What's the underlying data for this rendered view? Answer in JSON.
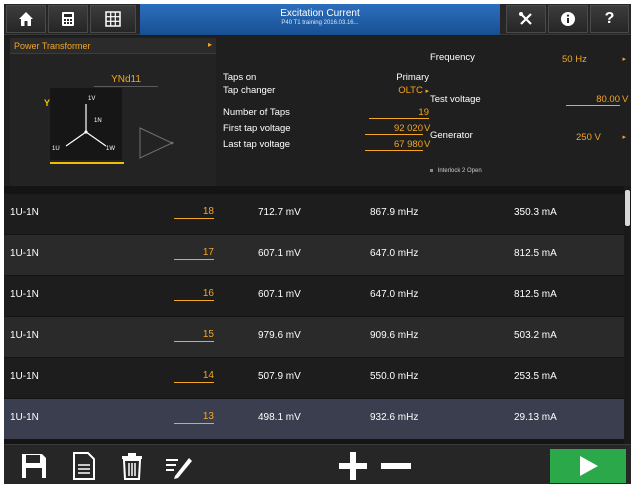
{
  "header": {
    "title": "Excitation Current",
    "subtitle": "P40 T1 training 2016.03.16..."
  },
  "icons": {
    "home": "home-icon",
    "calculator": "calculator-icon",
    "grid": "grid-icon",
    "tools": "tools-icon",
    "info": "info-icon",
    "help": "help-icon"
  },
  "buttons": {
    "help_label": "?"
  },
  "transformer": {
    "type_label": "Power Transformer",
    "vector_group": "YNd11",
    "primary_winding": "YN",
    "secondary_winding": "d11",
    "phase_1v": "1V",
    "phase_1n": "1N",
    "phase_1u": "1U",
    "phase_1w": "1W"
  },
  "taps": {
    "taps_on_label": "Taps on",
    "taps_on_value": "Primary",
    "tap_changer_label": "Tap changer",
    "tap_changer_value": "OLTC",
    "number_of_taps_label": "Number of Taps",
    "number_of_taps_value": "19",
    "first_tap_voltage_label": "First tap voltage",
    "first_tap_voltage_value": "92 020",
    "last_tap_voltage_label": "Last tap voltage",
    "last_tap_voltage_value": "67 980",
    "voltage_unit": "V"
  },
  "measurement": {
    "frequency_label": "Frequency",
    "frequency_value": "50 Hz",
    "test_voltage_label": "Test voltage",
    "test_voltage_value": "80.00",
    "test_voltage_unit": "V",
    "generator_label": "Generator",
    "generator_value": "250 V",
    "interlock_text": "Interlock 2 Open"
  },
  "table": {
    "rows": [
      {
        "phase": "1U-1N",
        "tap": "18",
        "voltage": "712.7 mV",
        "frequency": "867.9 mHz",
        "current": "350.3 mA"
      },
      {
        "phase": "1U-1N",
        "tap": "17",
        "voltage": "607.1 mV",
        "frequency": "647.0 mHz",
        "current": "812.5 mA"
      },
      {
        "phase": "1U-1N",
        "tap": "16",
        "voltage": "607.1 mV",
        "frequency": "647.0 mHz",
        "current": "812.5 mA"
      },
      {
        "phase": "1U-1N",
        "tap": "15",
        "voltage": "979.6 mV",
        "frequency": "909.6 mHz",
        "current": "503.2 mA"
      },
      {
        "phase": "1U-1N",
        "tap": "14",
        "voltage": "507.9 mV",
        "frequency": "550.0 mHz",
        "current": "253.5 mA"
      },
      {
        "phase": "1U-1N",
        "tap": "13",
        "voltage": "498.1 mV",
        "frequency": "932.6 mHz",
        "current": "29.13 mA"
      }
    ],
    "selected_row": 5
  },
  "toolbar": {
    "save_icon": "save-icon",
    "report_icon": "report-icon",
    "delete_icon": "trash-icon",
    "edit_icon": "edit-icon",
    "add_icon": "plus-icon",
    "remove_icon": "minus-icon",
    "run_icon": "play-icon"
  },
  "colors": {
    "accent": "#f5a623",
    "title_bar": "#1f5fa8",
    "run_button": "#2aa84a",
    "selected_row": "#3a3e4e",
    "background": "#1b1b1b"
  }
}
